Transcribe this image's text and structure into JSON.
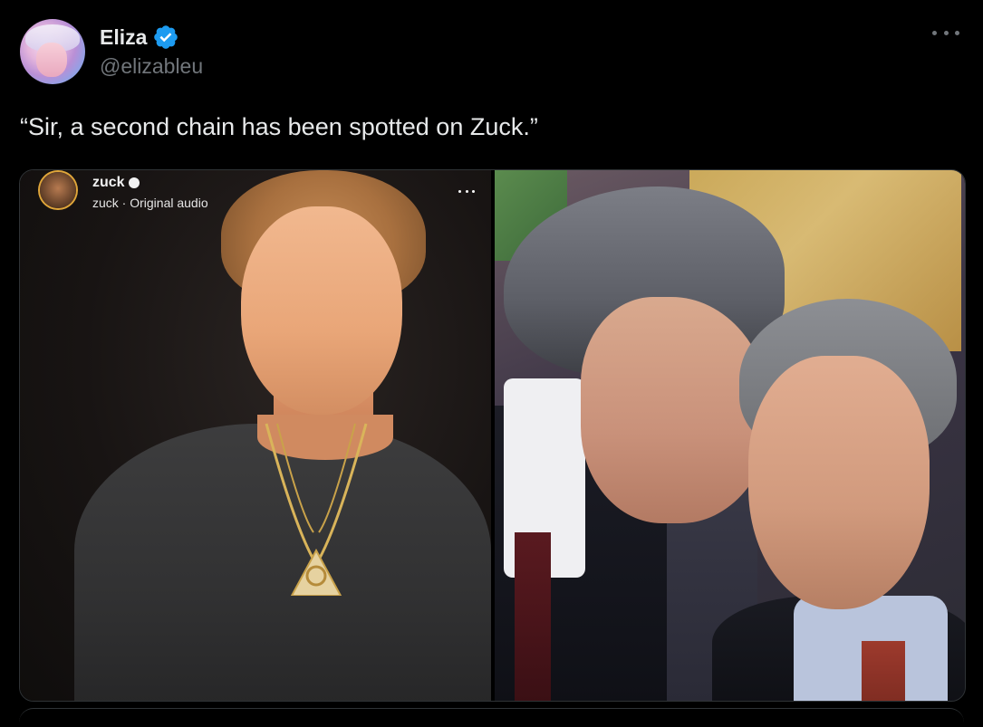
{
  "tweet": {
    "author_name": "Eliza",
    "author_handle": "@elizableu",
    "text": "“Sir, a second chain has been spotted on Zuck.”"
  },
  "media": {
    "left_overlay": {
      "username": "zuck",
      "subtitle": "zuck · Original audio"
    }
  },
  "colors": {
    "background": "#000000",
    "text_primary": "#e7e9ea",
    "text_secondary": "#71767b",
    "verified_blue": "#1d9bf0"
  },
  "icons": {
    "verified": "verified-badge-icon",
    "more": "more-options-icon"
  }
}
